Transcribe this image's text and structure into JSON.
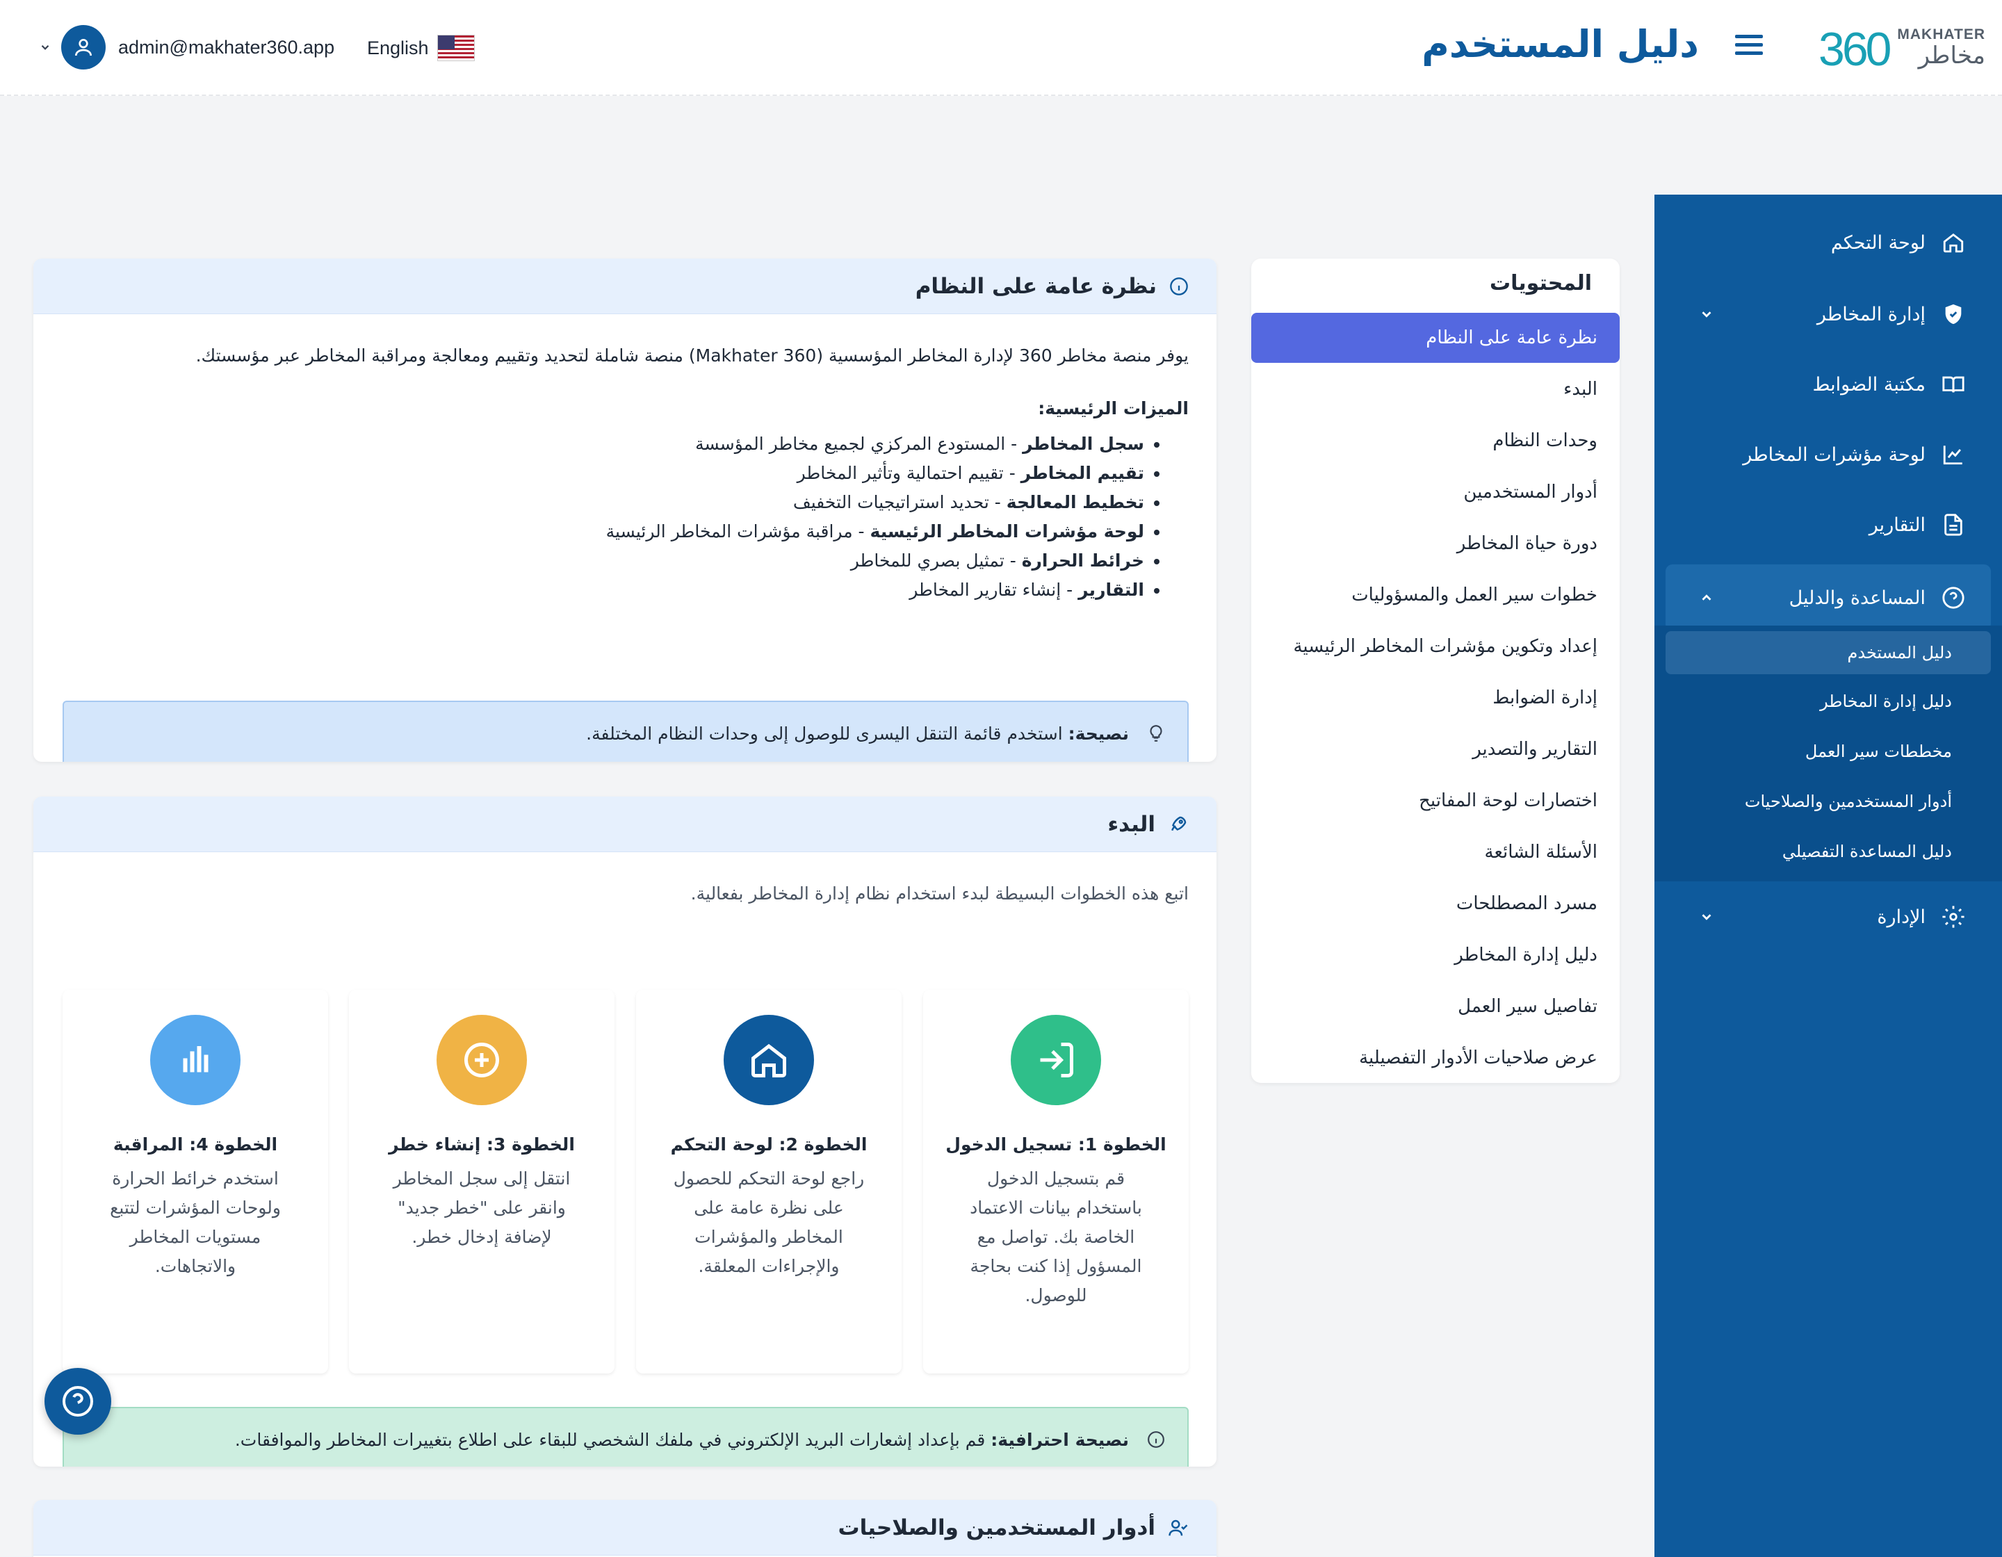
{
  "header": {
    "logo_number": "360",
    "logo_en": "MAKHATER",
    "logo_ar": "مخاطر",
    "title": "دليل المستخدم",
    "language": "English",
    "user_email": "admin@makhater360.app"
  },
  "sidebar": {
    "items": [
      {
        "label": "لوحة التحكم",
        "icon": "home-icon"
      },
      {
        "label": "إدارة المخاطر",
        "icon": "shield-icon"
      },
      {
        "label": "مكتبة الضوابط",
        "icon": "book-icon"
      },
      {
        "label": "لوحة مؤشرات المخاطر",
        "icon": "chart-line-icon"
      },
      {
        "label": "التقارير",
        "icon": "document-icon"
      },
      {
        "label": "المساعدة والدليل",
        "icon": "help-circle-icon"
      },
      {
        "label": "الإدارة",
        "icon": "gear-icon"
      }
    ],
    "subitems": [
      {
        "label": "دليل المستخدم"
      },
      {
        "label": "دليل إدارة المخاطر"
      },
      {
        "label": "مخططات سير العمل"
      },
      {
        "label": "أدوار المستخدمين والصلاحيات"
      },
      {
        "label": "دليل المساعدة التفصيلي"
      }
    ]
  },
  "toc": {
    "title": "المحتويات",
    "items": [
      "نظرة عامة على النظام",
      "البدء",
      "وحدات النظام",
      "أدوار المستخدمين",
      "دورة حياة المخاطر",
      "خطوات سير العمل والمسؤوليات",
      "إعداد وتكوين مؤشرات المخاطر الرئيسية",
      "إدارة الضوابط",
      "التقارير والتصدير",
      "اختصارات لوحة المفاتيح",
      "الأسئلة الشائعة",
      "مسرد المصطلحات",
      "دليل إدارة المخاطر",
      "تفاصيل سير العمل",
      "عرض صلاحيات الأدوار التفصيلية"
    ]
  },
  "overview": {
    "title": "نظرة عامة على النظام",
    "intro": "يوفر منصة مخاطر 360 لإدارة المخاطر المؤسسية (Makhater 360) منصة شاملة لتحديد وتقييم ومعالجة ومراقبة المخاطر عبر مؤسستك.",
    "features_title": "الميزات الرئيسية:",
    "features": [
      {
        "name": "سجل المخاطر",
        "desc": " - المستودع المركزي لجميع مخاطر المؤسسة"
      },
      {
        "name": "تقييم المخاطر",
        "desc": " - تقييم احتمالية وتأثير المخاطر"
      },
      {
        "name": "تخطيط المعالجة",
        "desc": " - تحديد استراتيجيات التخفيف"
      },
      {
        "name": "لوحة مؤشرات المخاطر الرئيسية",
        "desc": " - مراقبة مؤشرات المخاطر الرئيسية"
      },
      {
        "name": "خرائط الحرارة",
        "desc": " - تمثيل بصري للمخاطر"
      },
      {
        "name": "التقارير",
        "desc": " - إنشاء تقارير المخاطر"
      }
    ],
    "tip_label": "نصيحة:",
    "tip_text": " استخدم قائمة التنقل اليسرى للوصول إلى وحدات النظام المختلفة."
  },
  "getting_started": {
    "title": "البدء",
    "intro": "اتبع هذه الخطوات البسيطة لبدء استخدام نظام إدارة المخاطر بفعالية.",
    "steps": [
      {
        "title": "الخطوة 1: تسجيل الدخول",
        "text": "قم بتسجيل الدخول باستخدام بيانات الاعتماد الخاصة بك. تواصل مع المسؤول إذا كنت بحاجة للوصول.",
        "color": "#2fbf8a",
        "icon": "login-icon"
      },
      {
        "title": "الخطوة 2: لوحة التحكم",
        "text": "راجع لوحة التحكم للحصول على نظرة عامة على المخاطر والمؤشرات والإجراءات المعلقة.",
        "color": "#0e5a9c",
        "icon": "home-icon"
      },
      {
        "title": "الخطوة 3: إنشاء خطر",
        "text": "انتقل إلى سجل المخاطر وانقر على \"خطر جديد\" لإضافة إدخال خطر.",
        "color": "#f0b345",
        "icon": "plus-circle-icon"
      },
      {
        "title": "الخطوة 4: المراقبة",
        "text": "استخدم خرائط الحرارة ولوحات المؤشرات لتتبع مستويات المخاطر والاتجاهات.",
        "color": "#56a8ee",
        "icon": "bar-chart-icon"
      }
    ],
    "pro_tip_label": "نصيحة احترافية:",
    "pro_tip_text": " قم بإعداد إشعارات البريد الإلكتروني في ملفك الشخصي للبقاء على اطلاع بتغييرات المخاطر والموافقات."
  },
  "roles_section": {
    "title": "أدوار المستخدمين والصلاحيات"
  }
}
